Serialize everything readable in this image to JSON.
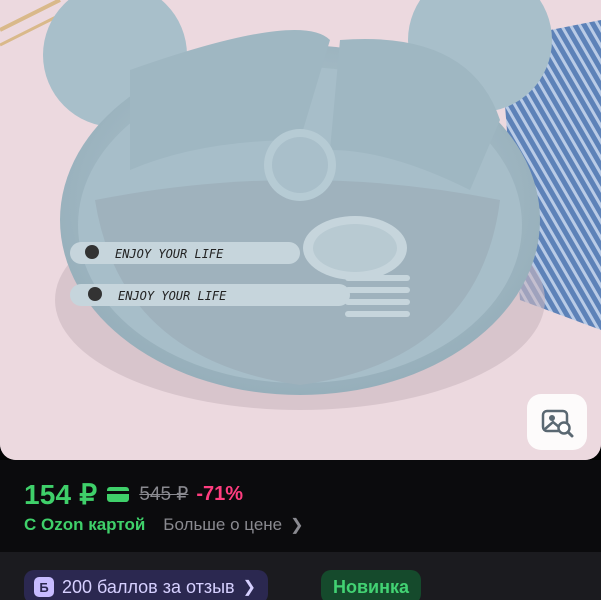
{
  "product": {
    "image_alt": "Детская тарелка с секциями, ложкой и вилкой",
    "utensil_engraving": "ENJOY YOUR LIFE"
  },
  "price": {
    "current": "154 ₽",
    "old": "545 ₽",
    "discount": "-71%",
    "ozon_card_label": "С Ozon картой",
    "more_about_price": "Больше о цене"
  },
  "badges": {
    "reviews_icon_letter": "Б",
    "reviews_label": "200 баллов за отзыв",
    "new_label": "Новинка"
  },
  "icons": {
    "visual_search": "image-search-icon",
    "card": "card-icon",
    "chevron": "chevron-right-icon"
  },
  "colors": {
    "price_green": "#3fd06a",
    "discount_pink": "#ff3d7f",
    "background": "#0b0b0d"
  }
}
